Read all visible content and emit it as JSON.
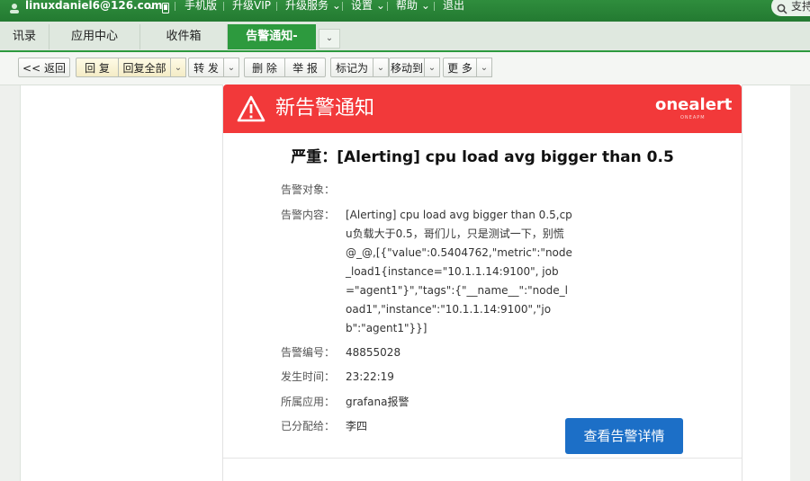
{
  "topbar": {
    "account": "linuxdaniel6@126.com",
    "mobile": "手机版",
    "vip": "升级VIP",
    "upgrade": "升级服务",
    "settings": "设置",
    "help": "帮助",
    "logout": "退出",
    "search_placeholder": "支持"
  },
  "tabs": [
    {
      "label": "讯录"
    },
    {
      "label": "应用中心"
    },
    {
      "label": "收件箱"
    },
    {
      "label": "告警通知-严..."
    }
  ],
  "toolbar": {
    "back": "<< 返回",
    "reply": "回 复",
    "reply_all": "回复全部",
    "forward": "转 发",
    "delete": "删 除",
    "report": "举 报",
    "mark_as": "标记为",
    "move_to": "移动到",
    "more": "更 多"
  },
  "email": {
    "header_title": "新告警通知",
    "logo": "onealert",
    "logo_sub": "ONEAPM",
    "alert_title": "严重：[Alerting] cpu load avg bigger than 0.5",
    "fields": [
      {
        "label": "告警对象：",
        "value": ""
      },
      {
        "label": "告警内容：",
        "value": "[Alerting] cpu load avg bigger than 0.5,cpu负载大于0.5，哥们儿，只是测试一下，别慌@_@,[{\"value\":0.5404762,\"metric\":\"node_load1{instance=\"10.1.1.14:9100\", job=\"agent1\"}\",\"tags\":{\"__name__\":\"node_load1\",\"instance\":\"10.1.1.14:9100\",\"job\":\"agent1\"}}]"
      },
      {
        "label": "告警编号：",
        "value": "48855028"
      },
      {
        "label": "发生时间：",
        "value": "23:22:19"
      },
      {
        "label": "所属应用：",
        "value": "grafana报警"
      },
      {
        "label": "已分配给：",
        "value": "李四"
      }
    ],
    "detail_button": "查看告警详情"
  }
}
